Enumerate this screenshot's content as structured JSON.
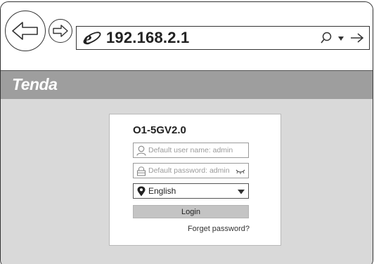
{
  "browser": {
    "url": "192.168.2.1",
    "icons": [
      "back-arrow-icon",
      "forward-arrow-icon",
      "internet-explorer-icon",
      "search-icon",
      "dropdown-arrow-icon",
      "go-arrow-icon"
    ]
  },
  "brand": {
    "logo_text": "Tenda"
  },
  "login": {
    "model": "O1-5GV2.0",
    "username_placeholder": "Default user name: admin",
    "password_placeholder": "Default password: admin",
    "language_value": "English",
    "login_label": "Login",
    "forget_password": "Forget password?"
  },
  "colors": {
    "page_background": "#d9d9d9",
    "brand_bar": "#9e9e9e",
    "button_background": "#c4c4c4"
  }
}
